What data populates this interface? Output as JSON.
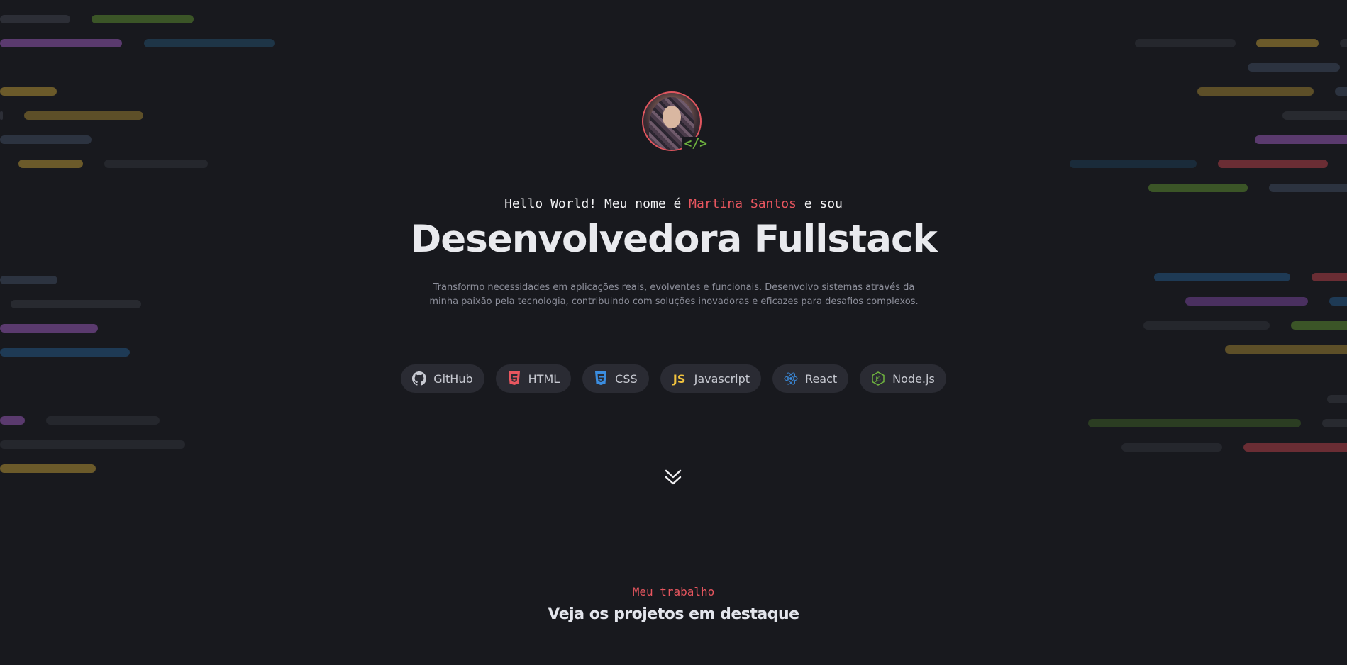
{
  "colors": {
    "background": "#18191e",
    "accent": "#e8565f",
    "chip_background": "#2a2b33",
    "text_primary": "#e9eaee",
    "text_muted": "#8d8f9b"
  },
  "hero": {
    "greeting_prefix": "Hello World! Meu nome é ",
    "greeting_name": "Martina Santos",
    "greeting_suffix": " e sou",
    "title": "Desenvolvedora Fullstack",
    "description_line1": "Transformo necessidades em aplicações reais, evolventes e funcionais. Desenvolvo sistemas através da",
    "description_line2": "minha paixão pela tecnologia, contribuindo com soluções inovadoras e eficazes para desafios complexos.",
    "avatar_badge": "</>"
  },
  "tech": [
    {
      "label": "GitHub",
      "icon": "github-icon"
    },
    {
      "label": "HTML",
      "icon": "html5-icon"
    },
    {
      "label": "CSS",
      "icon": "css3-icon"
    },
    {
      "label": "Javascript",
      "icon": "js-icon",
      "icon_text": "JS"
    },
    {
      "label": "React",
      "icon": "react-icon"
    },
    {
      "label": "Node.js",
      "icon": "nodejs-icon"
    }
  ],
  "scroll": {
    "icon": "chevron-double-down-icon"
  },
  "work_section": {
    "kicker": "Meu trabalho",
    "title": "Veja os projetos em destaque"
  }
}
